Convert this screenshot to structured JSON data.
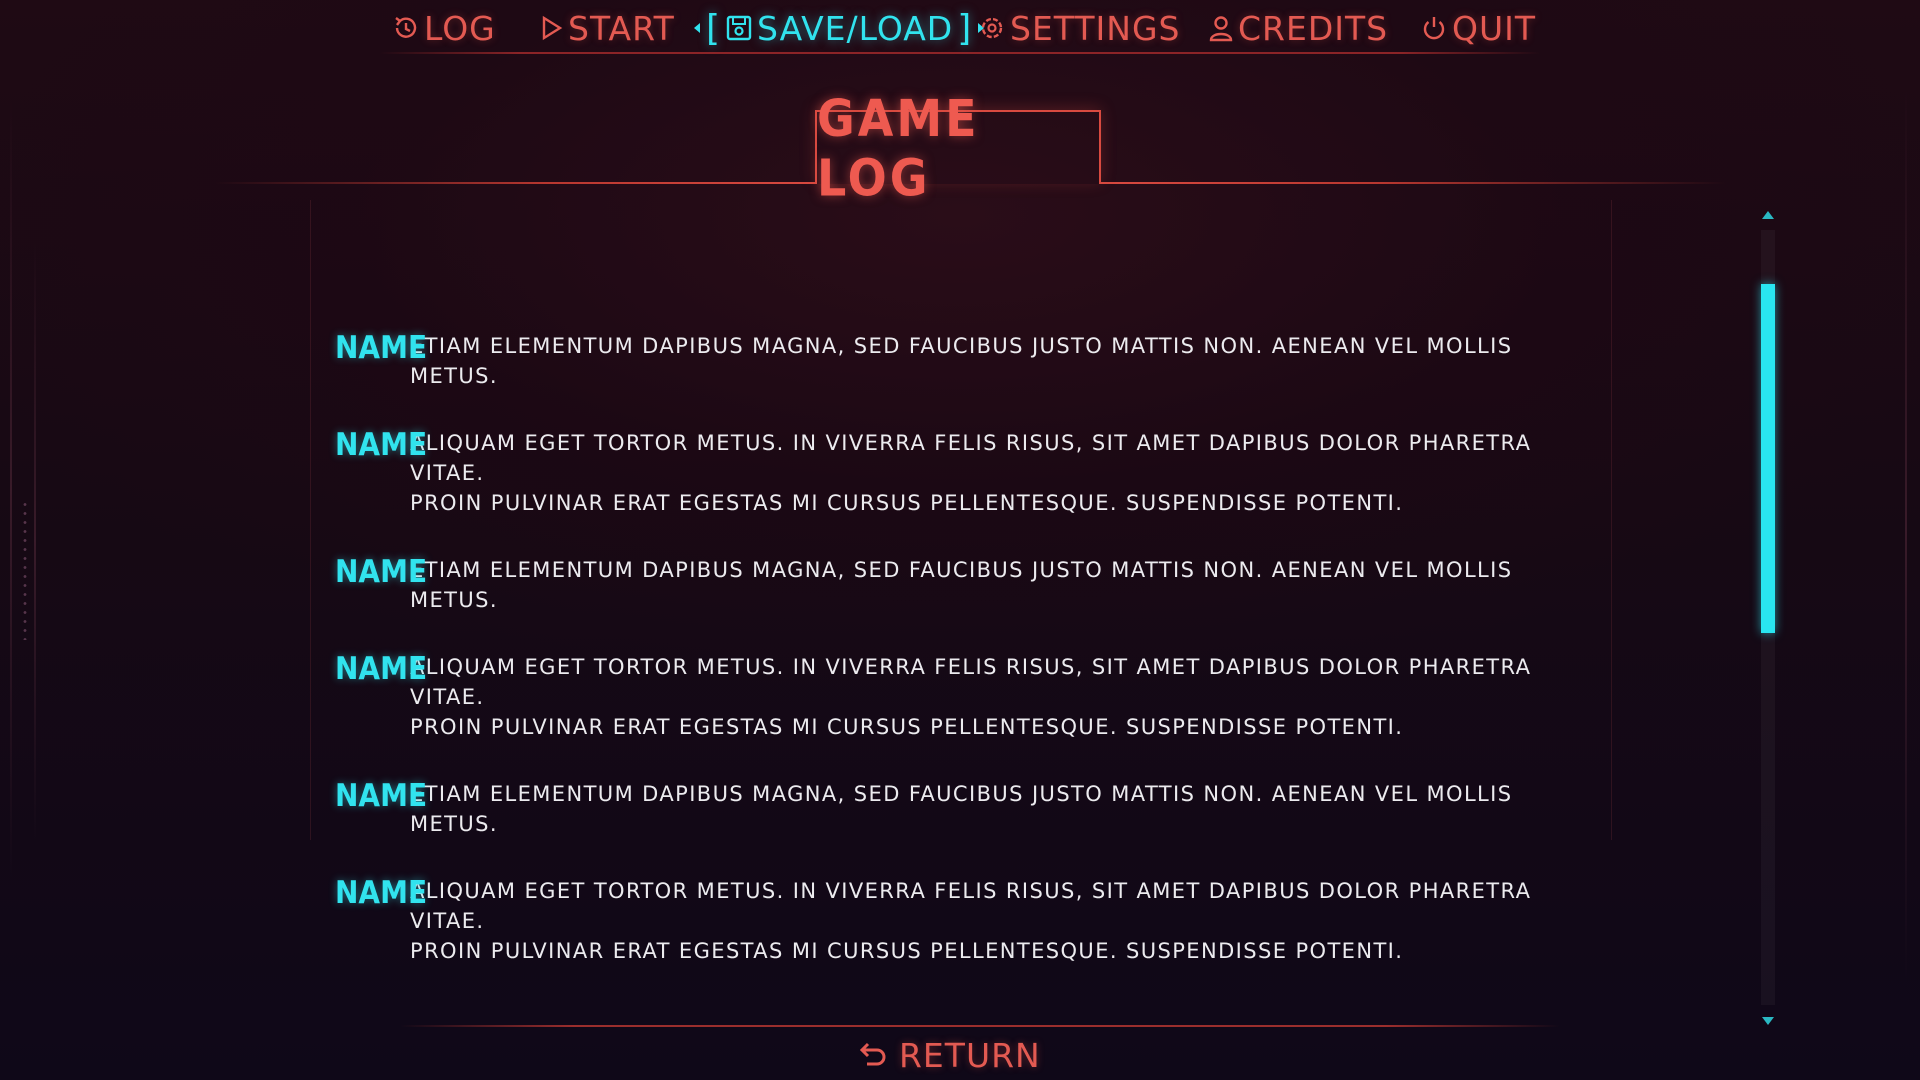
{
  "menu": {
    "items": [
      {
        "label": "LOG",
        "icon": "history-icon",
        "active": false
      },
      {
        "label": "START",
        "icon": "play-icon",
        "active": false
      },
      {
        "label": "SAVE/LOAD",
        "icon": "save-icon",
        "active": true
      },
      {
        "label": "SETTINGS",
        "icon": "gear-icon",
        "active": false
      },
      {
        "label": "CREDITS",
        "icon": "user-icon",
        "active": false
      },
      {
        "label": "QUIT",
        "icon": "power-icon",
        "active": false
      }
    ]
  },
  "title": "GAME LOG",
  "log": [
    {
      "name": "NAME",
      "lines": [
        "ETIAM ELEMENTUM DAPIBUS MAGNA, SED FAUCIBUS JUSTO MATTIS NON. AENEAN VEL MOLLIS METUS."
      ]
    },
    {
      "name": "NAME",
      "lines": [
        "ALIQUAM EGET TORTOR METUS. IN VIVERRA FELIS RISUS, SIT AMET DAPIBUS DOLOR PHARETRA VITAE.",
        "PROIN PULVINAR ERAT EGESTAS MI CURSUS PELLENTESQUE. SUSPENDISSE POTENTI."
      ]
    },
    {
      "name": "NAME",
      "lines": [
        "ETIAM ELEMENTUM DAPIBUS MAGNA, SED FAUCIBUS JUSTO MATTIS NON. AENEAN VEL MOLLIS METUS."
      ]
    },
    {
      "name": "NAME",
      "lines": [
        "ALIQUAM EGET TORTOR METUS. IN VIVERRA FELIS RISUS, SIT AMET DAPIBUS DOLOR PHARETRA VITAE.",
        "PROIN PULVINAR ERAT EGESTAS MI CURSUS PELLENTESQUE. SUSPENDISSE POTENTI."
      ]
    },
    {
      "name": "NAME",
      "lines": [
        "ETIAM ELEMENTUM DAPIBUS MAGNA, SED FAUCIBUS JUSTO MATTIS NON. AENEAN VEL MOLLIS METUS."
      ]
    },
    {
      "name": "NAME",
      "lines": [
        "ALIQUAM EGET TORTOR METUS. IN VIVERRA FELIS RISUS, SIT AMET DAPIBUS DOLOR PHARETRA VITAE.",
        "PROIN PULVINAR ERAT EGESTAS MI CURSUS PELLENTESQUE. SUSPENDISSE POTENTI."
      ]
    }
  ],
  "scrollbar": {
    "thumb_start": 0.07,
    "thumb_fraction": 0.45
  },
  "return_label": "RETURN",
  "colors": {
    "accent_red": "#e35a52",
    "accent_cyan": "#31e3ee",
    "text": "#ecebef"
  }
}
